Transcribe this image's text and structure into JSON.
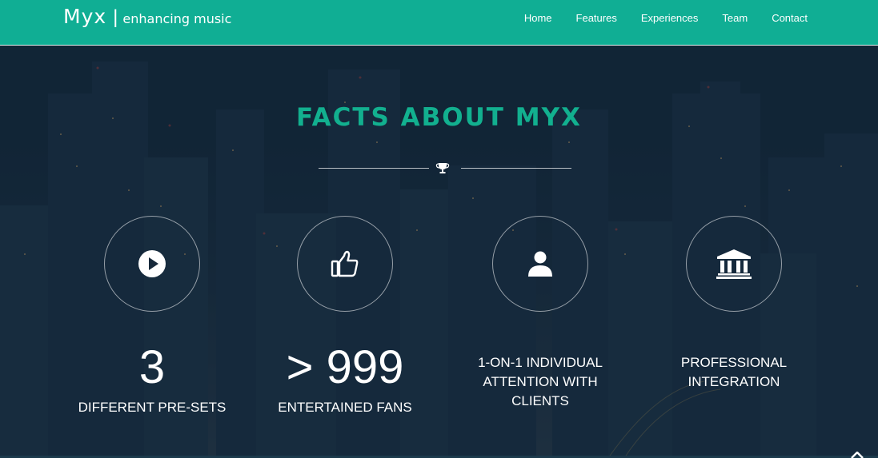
{
  "brand": {
    "name": "Myx",
    "separator": "|",
    "tagline": "enhancing music"
  },
  "nav": {
    "items": [
      "Home",
      "Features",
      "Experiences",
      "Team",
      "Contact"
    ]
  },
  "section": {
    "title": "FACTS ABOUT MYX"
  },
  "facts": [
    {
      "icon": "play-icon",
      "number": "3",
      "label": "DIFFERENT PRE-SETS"
    },
    {
      "icon": "thumbs-up-icon",
      "number": "> 999",
      "label": "ENTERTAINED FANS"
    },
    {
      "icon": "user-icon",
      "label": "1-ON-1 INDIVIDUAL ATTENTION WITH CLIENTS"
    },
    {
      "icon": "institution-icon",
      "label": "PROFESSIONAL INTEGRATION"
    }
  ],
  "colors": {
    "navbar": "#10ae94",
    "accent": "#12b08f",
    "background": "#16293a"
  }
}
